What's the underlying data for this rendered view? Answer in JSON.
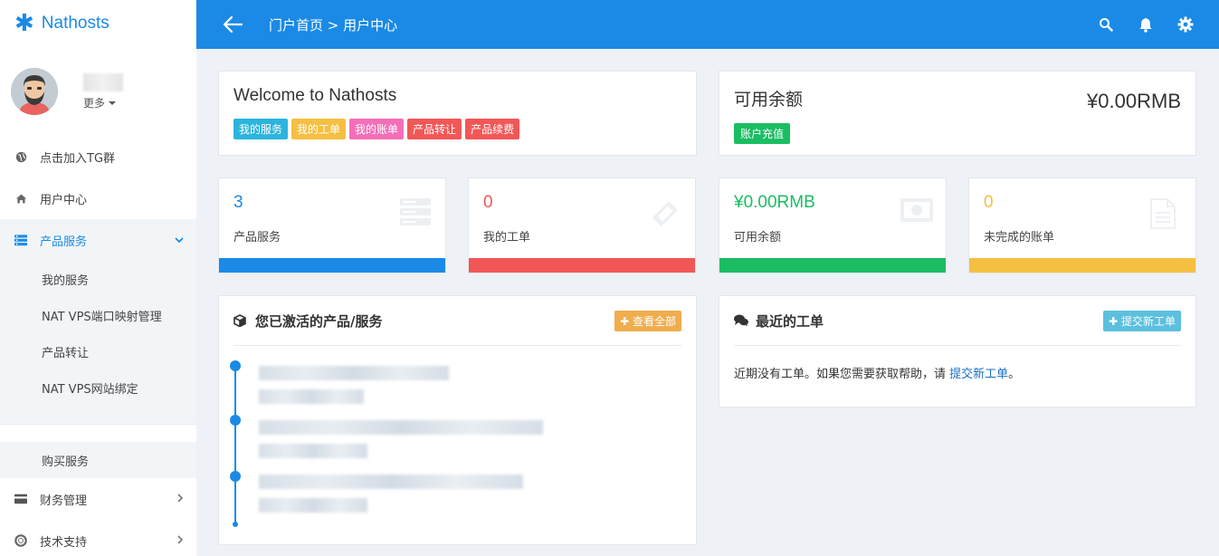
{
  "brand": {
    "name": "Nathosts"
  },
  "user": {
    "more_label": "更多"
  },
  "sidebar": {
    "items": [
      {
        "label": "点击加入TG群",
        "icon": "globe-icon"
      },
      {
        "label": "用户中心",
        "icon": "home-icon"
      },
      {
        "label": "产品服务",
        "icon": "server-icon",
        "expanded": true
      },
      {
        "label": "财务管理",
        "icon": "card-icon"
      },
      {
        "label": "技术支持",
        "icon": "lifering-icon"
      }
    ],
    "sub_items": [
      "我的服务",
      "NAT VPS端口映射管理",
      "产品转让",
      "NAT VPS网站绑定",
      "购买服务"
    ]
  },
  "topbar": {
    "breadcrumb": "门户首页 > 用户中心"
  },
  "welcome": {
    "title": "Welcome to Nathosts",
    "tags": [
      {
        "label": "我的服务",
        "color": "#2bb4dd"
      },
      {
        "label": "我的工单",
        "color": "#f5bf42"
      },
      {
        "label": "我的账单",
        "color": "#f56eb7"
      },
      {
        "label": "产品转让",
        "color": "#f25757"
      },
      {
        "label": "产品续费",
        "color": "#f25757"
      }
    ]
  },
  "balance": {
    "label": "可用余额",
    "amount": "¥0.00RMB",
    "recharge": "账户充值"
  },
  "stats": [
    {
      "value": "3",
      "label": "产品服务",
      "color": "#1a8ae6",
      "icon": "server-icon"
    },
    {
      "value": "0",
      "label": "我的工单",
      "color": "#f25757",
      "icon": "ticket-icon"
    },
    {
      "value": "¥0.00RMB",
      "label": "可用余额",
      "color": "#1bbd63",
      "icon": "money-icon"
    },
    {
      "value": "0",
      "label": "未完成的账单",
      "color": "#f5bf42",
      "icon": "document-icon"
    }
  ],
  "products": {
    "title": "您已激活的产品/服务",
    "view_all": "查看全部"
  },
  "tickets": {
    "title": "最近的工单",
    "submit": "提交新工单",
    "empty_prefix": "近期没有工单。如果您需要获取帮助，请 ",
    "empty_link": "提交新工单",
    "empty_suffix": "。"
  }
}
